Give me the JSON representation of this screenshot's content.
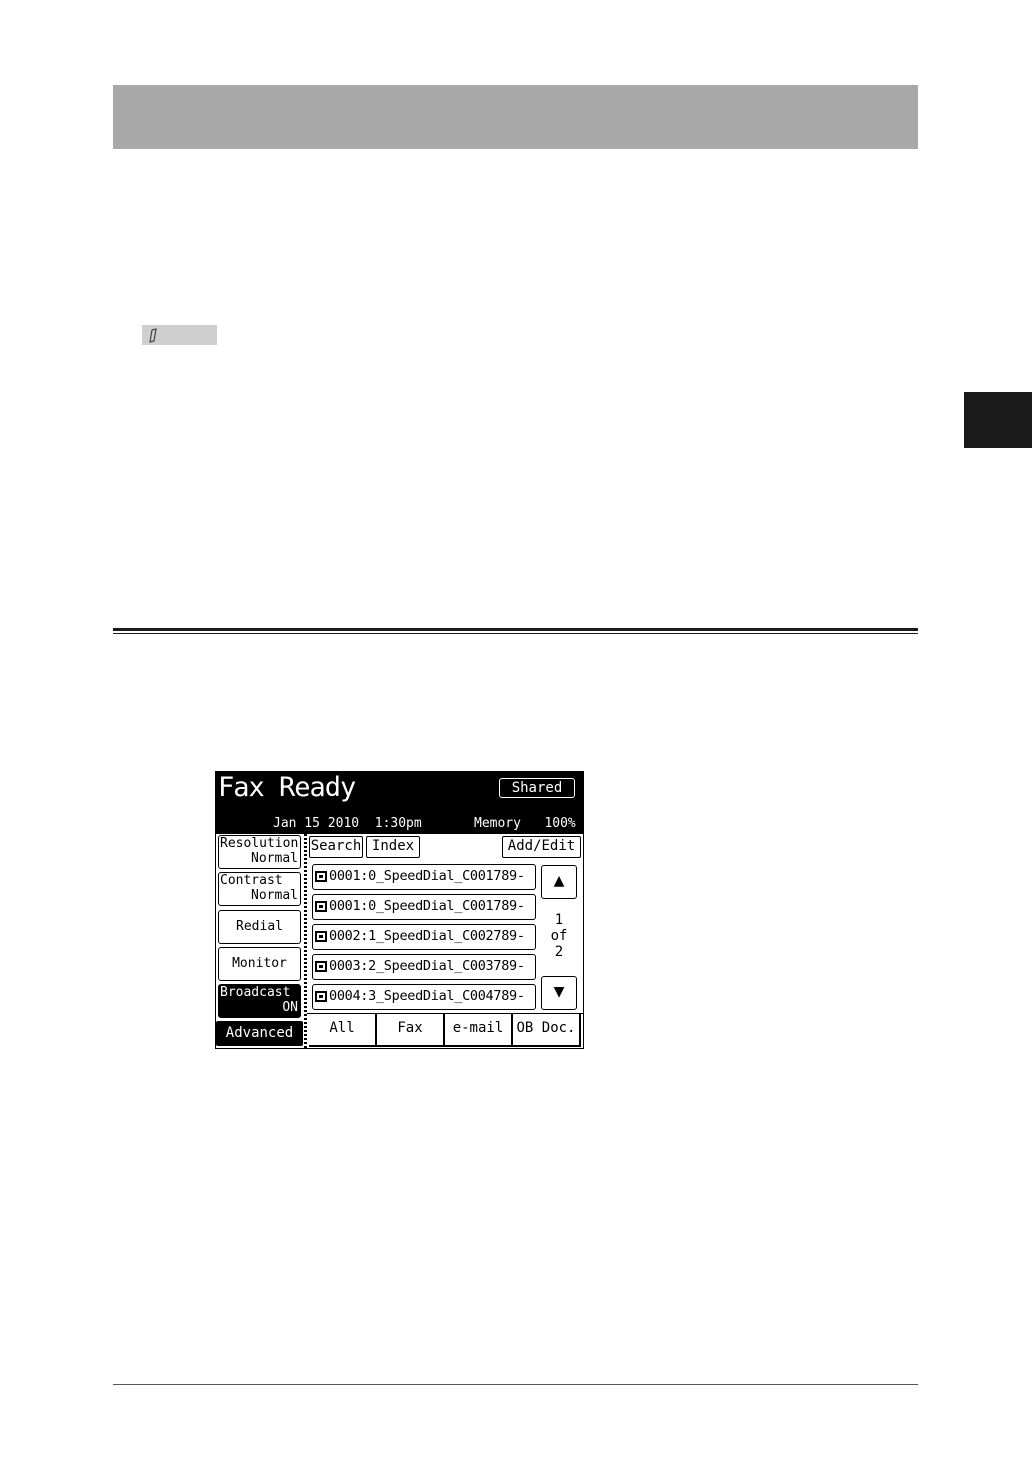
{
  "panel": {
    "title": "Fax Ready",
    "shared_label": "Shared",
    "date": "Jan 15 2010",
    "time": "1:30pm",
    "memory_label": "Memory",
    "memory_value": "100%",
    "side_buttons": {
      "resolution": {
        "label": "Resolution",
        "value": "Normal"
      },
      "contrast": {
        "label": "Contrast",
        "value": "Normal"
      },
      "redial": {
        "label": "Redial"
      },
      "monitor": {
        "label": "Monitor"
      },
      "broadcast": {
        "label": "Broadcast",
        "value": "ON"
      },
      "advanced": {
        "label": "Advanced"
      }
    },
    "toolbar": {
      "search": "Search",
      "index": "Index",
      "add_edit": "Add/Edit"
    },
    "entries": [
      {
        "text": "0001:0_SpeedDial_C001789-",
        "icon": "fax-icon"
      },
      {
        "text": "0001:0_SpeedDial_C001789-",
        "icon": "email-icon"
      },
      {
        "text": "0002:1_SpeedDial_C002789-",
        "icon": "email-icon"
      },
      {
        "text": "0003:2_SpeedDial_C003789-",
        "icon": "fax-icon"
      },
      {
        "text": "0004:3_SpeedDial_C004789-",
        "icon": "fax-icon"
      }
    ],
    "pager": {
      "current": "1",
      "of": "of",
      "total": "2",
      "up": "▲",
      "down": "▼"
    },
    "tabs": [
      "All",
      "Fax",
      "e-mail",
      "OB Doc."
    ]
  }
}
